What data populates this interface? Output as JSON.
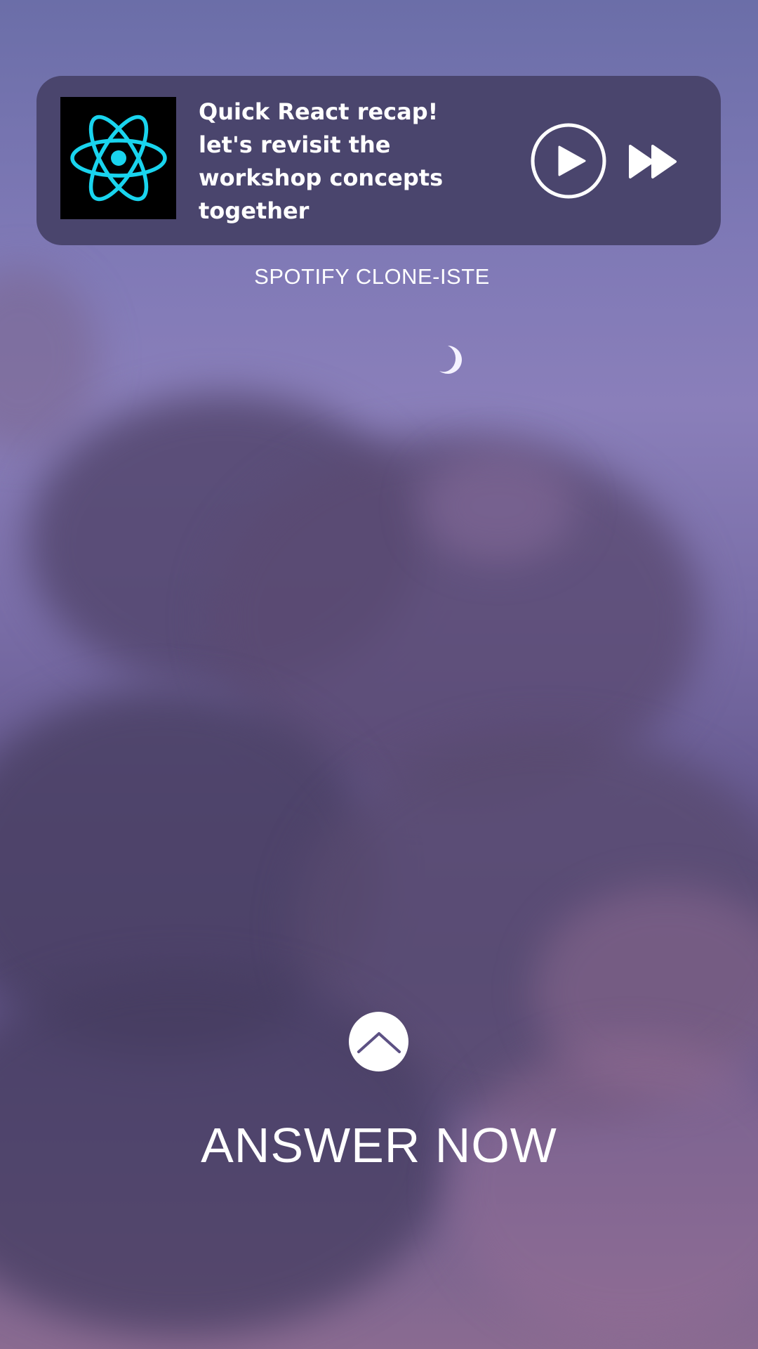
{
  "player": {
    "cover_icon": "react-logo-icon",
    "track_title": "Quick React recap! let's revisit the workshop concepts together",
    "play_icon": "play-circle-icon",
    "next_icon": "fast-forward-icon",
    "colors": {
      "card_bg": "#4a456d",
      "react_cyan": "#19d4ee"
    }
  },
  "app": {
    "name": "SPOTIFY CLONE-ISTE",
    "moon_icon": "crescent-moon-icon"
  },
  "cta": {
    "icon": "chevron-up-icon",
    "label": "ANSWER NOW"
  }
}
